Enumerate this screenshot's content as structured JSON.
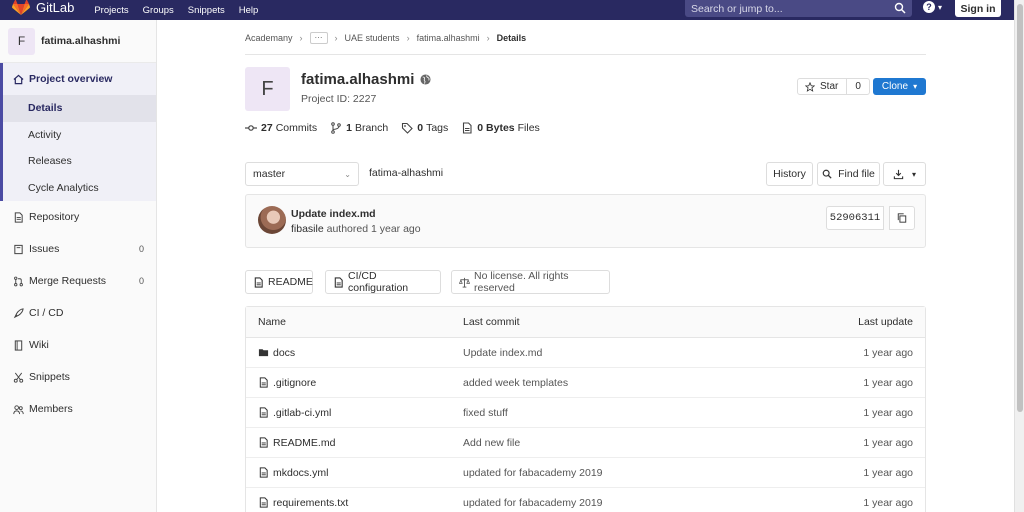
{
  "topbar": {
    "brand": "GitLab",
    "links": [
      "Projects",
      "Groups",
      "Snippets",
      "Help"
    ],
    "search_placeholder": "Search or jump to...",
    "help_glyph": "?",
    "sign_in": "Sign in"
  },
  "sidebar": {
    "avatar_letter": "F",
    "project_name": "fatima.alhashmi",
    "overview_label": "Project overview",
    "overview_items": [
      "Details",
      "Activity",
      "Releases",
      "Cycle Analytics"
    ],
    "items": [
      {
        "label": "Repository",
        "icon": "repository-icon"
      },
      {
        "label": "Issues",
        "icon": "issues-icon",
        "count": "0"
      },
      {
        "label": "Merge Requests",
        "icon": "merge-request-icon",
        "count": "0"
      },
      {
        "label": "CI / CD",
        "icon": "rocket-icon"
      },
      {
        "label": "Wiki",
        "icon": "book-icon"
      },
      {
        "label": "Snippets",
        "icon": "scissors-icon"
      },
      {
        "label": "Members",
        "icon": "users-icon"
      }
    ]
  },
  "breadcrumb": [
    "Academany",
    "UAE students",
    "fatima.alhashmi",
    "Details"
  ],
  "project": {
    "avatar_letter": "F",
    "title": "fatima.alhashmi",
    "id_label": "Project ID: 2227",
    "star_label": "Star",
    "star_count": "0",
    "clone_label": "Clone"
  },
  "stats": [
    {
      "num": "27",
      "label": "Commits",
      "icon": "commit-icon"
    },
    {
      "num": "1",
      "label": "Branch",
      "icon": "branch-icon"
    },
    {
      "num": "0",
      "label": "Tags",
      "icon": "tag-icon"
    },
    {
      "num": "0 Bytes",
      "label": "Files",
      "icon": "file-size-icon"
    }
  ],
  "toolbar": {
    "branch": "master",
    "path": "fatima-alhashmi",
    "history": "History",
    "find_file": "Find file"
  },
  "commit": {
    "message": "Update index.md",
    "author": "fibasile",
    "authored": "authored 1 year ago",
    "sha": "52906311"
  },
  "doc_buttons": [
    {
      "label": "README",
      "icon": "readme-icon"
    },
    {
      "label": "CI/CD configuration",
      "icon": "cicd-doc-icon"
    },
    {
      "label": "No license. All rights reserved",
      "icon": "scale-icon"
    }
  ],
  "tree": {
    "headers": {
      "name": "Name",
      "commit": "Last commit",
      "date": "Last update"
    },
    "rows": [
      {
        "name": "docs",
        "type": "folder",
        "commit": "Update index.md",
        "date": "1 year ago"
      },
      {
        "name": ".gitignore",
        "type": "file",
        "commit": "added week templates",
        "date": "1 year ago"
      },
      {
        "name": ".gitlab-ci.yml",
        "type": "file",
        "commit": "fixed stuff",
        "date": "1 year ago"
      },
      {
        "name": "README.md",
        "type": "file",
        "commit": "Add new file",
        "date": "1 year ago"
      },
      {
        "name": "mkdocs.yml",
        "type": "file",
        "commit": "updated for fabacademy 2019",
        "date": "1 year ago"
      },
      {
        "name": "requirements.txt",
        "type": "file",
        "commit": "updated for fabacademy 2019",
        "date": "1 year ago"
      }
    ]
  },
  "colors": {
    "topbar": "#292961",
    "accent": "#1f78d1",
    "sidebar_active": "#4b4ba3"
  }
}
